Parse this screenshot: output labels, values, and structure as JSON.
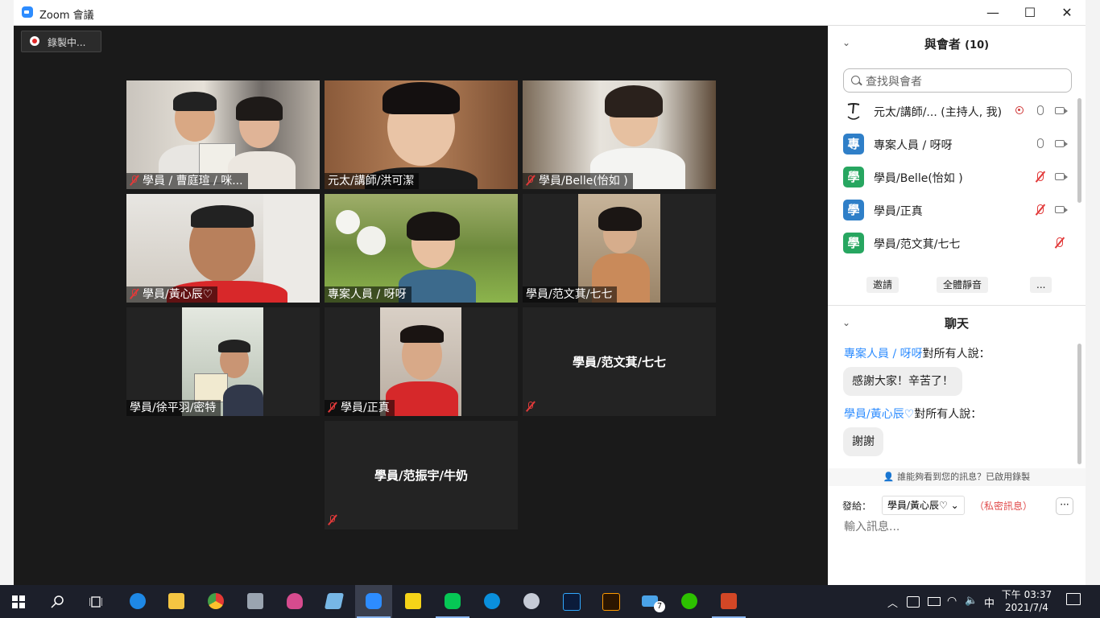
{
  "window": {
    "title": "Zoom 會議"
  },
  "recording": {
    "label": "錄製中..."
  },
  "tiles": [
    {
      "name": "學員 / 曹庭瑄 / 咪...",
      "muted": true
    },
    {
      "name": "元太/講師/洪可潔",
      "muted": false,
      "active": true
    },
    {
      "name": "學員/Belle(怡如 )",
      "muted": true
    },
    {
      "name": "學員/黃心辰♡",
      "muted": true
    },
    {
      "name": "專案人員 / 呀呀",
      "muted": false
    },
    {
      "name": "學員/范文萁/七七",
      "muted": false
    },
    {
      "name": "學員/徐平羽/密特",
      "muted": false
    },
    {
      "name": "學員/正真",
      "muted": true
    },
    {
      "name": "學員/范文萁/七七",
      "muted": true,
      "video_off": true
    },
    {
      "name": "學員/范振宇/牛奶",
      "muted": true,
      "video_off": true
    }
  ],
  "participants": {
    "title": "與會者",
    "count": "(10)",
    "search_placeholder": "查找與會者",
    "list": [
      {
        "avatar": "",
        "name": "元太/講師/...  (主持人, 我)",
        "mic": "on",
        "cam": true,
        "rec": true
      },
      {
        "avatar": "專",
        "name": "專案人員 / 呀呀",
        "mic": "on",
        "cam": true
      },
      {
        "avatar": "學",
        "name": "學員/Belle(怡如 )",
        "mic": "off",
        "cam": true
      },
      {
        "avatar": "學",
        "name": "學員/正真",
        "mic": "off",
        "cam": true
      },
      {
        "avatar": "學",
        "name": "學員/范文萁/七七",
        "mic": "off",
        "cam": false
      }
    ],
    "invite": "邀請",
    "mute_all": "全體靜音",
    "more": "..."
  },
  "chat": {
    "title": "聊天",
    "messages": [
      {
        "sender": "專案人員 / 呀呀",
        "suffix": "對所有人說：",
        "text": "感謝大家！辛苦了！"
      },
      {
        "sender": "學員/黃心辰♡",
        "suffix": "對所有人說：",
        "text": "謝謝"
      }
    ],
    "notice": "誰能夠看到您的訊息？已啟用錄製",
    "send_to_label": "發給：",
    "send_to_value": "學員/黃心辰♡ ⌄",
    "private": "（私密訊息）",
    "more": "···",
    "input_placeholder": "輸入訊息..."
  },
  "taskbar": {
    "ime": "中",
    "time": "下午 03:37",
    "date": "2021/7/4",
    "mail_badge": "7"
  },
  "colors": {
    "zoom_blue": "#2d8cff",
    "active_border": "#c6e43a",
    "muted_red": "#e23a3a"
  }
}
